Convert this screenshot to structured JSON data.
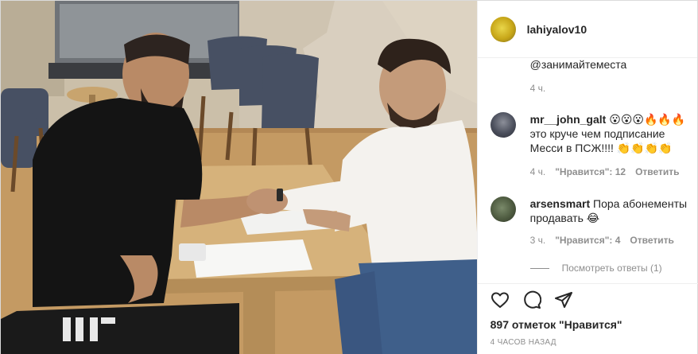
{
  "post": {
    "author": "lahiyalov10",
    "caption": "@занимайтеместа",
    "caption_time": "4 ч.",
    "comments": [
      {
        "username": "mr__john_galt",
        "text": "😮😮😮🔥🔥🔥 это круче чем подписание Месси в ПСЖ!!!! 👏👏👏👏",
        "time": "4 ч.",
        "likes": "\"Нравится\": 12",
        "reply_label": "Ответить"
      },
      {
        "username": "arsensmart",
        "text": "Пора абонементы продавать 😂",
        "time": "3 ч.",
        "likes": "\"Нравится\": 4",
        "reply_label": "Ответить"
      }
    ],
    "view_replies": "Посмотреть ответы (1)",
    "likes_summary": "897 отметок \"Нравится\"",
    "posted_ago": "4 ЧАСОВ НАЗАД"
  },
  "icons": {
    "like": "heart-icon",
    "comment": "comment-bubble-icon",
    "share": "paper-plane-icon"
  },
  "colors": {
    "text": "#262626",
    "secondary": "#8e8e8e",
    "border": "#dbdbdb"
  }
}
